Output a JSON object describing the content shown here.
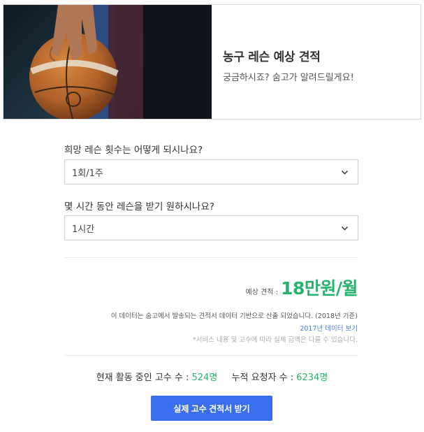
{
  "hero": {
    "title": "농구 레슨 예상 견적",
    "subtitle": "궁금하시죠? 숨고가 알려드릴게요!",
    "image_icon": "basketball-photo"
  },
  "questions": [
    {
      "label": "희망 레슨 횟수는 어떻게 되시나요?",
      "selected": "1회/1주"
    },
    {
      "label": "몇 시간 동안 레슨을 받기 원하시나요?",
      "selected": "1시간"
    }
  ],
  "estimate": {
    "label": "예상 견적 :",
    "value": "18만원/월"
  },
  "notes": {
    "source": "이 데이터는 숨고에서 발송되는 견적서 데이터 기반으로 산출 되었습니다. (2018년 기준)",
    "link": "2017년 데이터 보기",
    "disclaimer": "*서비스 내용 및 고수에 따라 실제 금액은 다를 수 있습니다."
  },
  "stats": {
    "active_label": "현재 활동 중인 고수 수 :",
    "active_value": "524명",
    "requests_label": "누적 요청자 수 :",
    "requests_value": "6234명"
  },
  "cta": {
    "label": "실제 고수 견적서 받기"
  },
  "colors": {
    "accent_green": "#26b36b",
    "primary_blue": "#3b6eef",
    "link_blue": "#4a7be0"
  }
}
